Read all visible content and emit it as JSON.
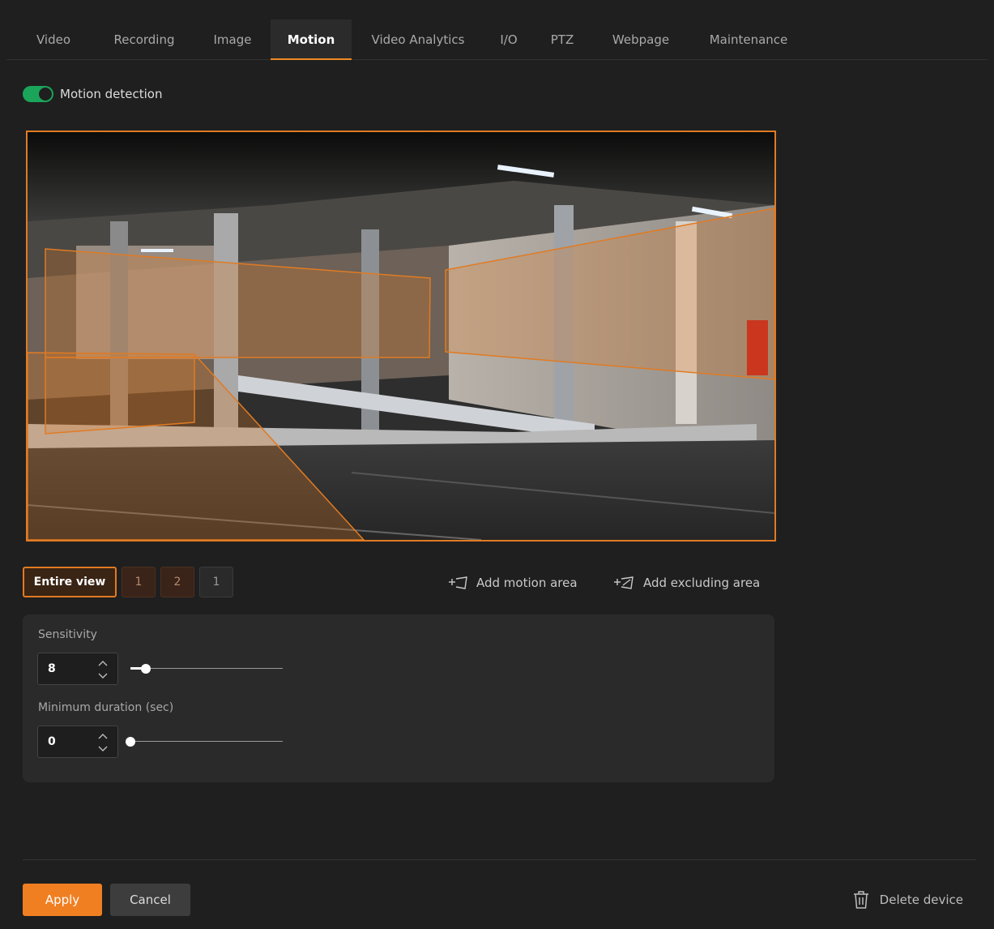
{
  "tabs": [
    {
      "label": "Video"
    },
    {
      "label": "Recording"
    },
    {
      "label": "Image"
    },
    {
      "label": "Motion"
    },
    {
      "label": "Video Analytics"
    },
    {
      "label": "I/O"
    },
    {
      "label": "PTZ"
    },
    {
      "label": "Webpage"
    },
    {
      "label": "Maintenance"
    }
  ],
  "active_tab": "Motion",
  "motion_detection": {
    "label": "Motion detection",
    "enabled": true
  },
  "areas": {
    "entire_view": "Entire view",
    "motion_areas": [
      "1",
      "2"
    ],
    "excluding_areas": [
      "1"
    ]
  },
  "actions": {
    "add_motion_area": "Add motion area",
    "add_excluding_area": "Add excluding area"
  },
  "sensitivity": {
    "label": "Sensitivity",
    "value": "8",
    "slider_fraction": 0.1
  },
  "minimum_duration": {
    "label": "Minimum duration (sec)",
    "value": "0",
    "slider_fraction": 0.0
  },
  "footer": {
    "apply": "Apply",
    "cancel": "Cancel",
    "delete_device": "Delete device"
  },
  "icons": {
    "add_motion_area": "add-area-icon",
    "add_excluding_area": "add-excluding-area-icon",
    "delete": "trash-icon",
    "toggle": "toggle-switch",
    "stepper": "chevron-up-down-icon"
  },
  "colors": {
    "accent": "#f07f22",
    "toggle_on": "#1aa55a",
    "area_outline": "#e07b23"
  }
}
